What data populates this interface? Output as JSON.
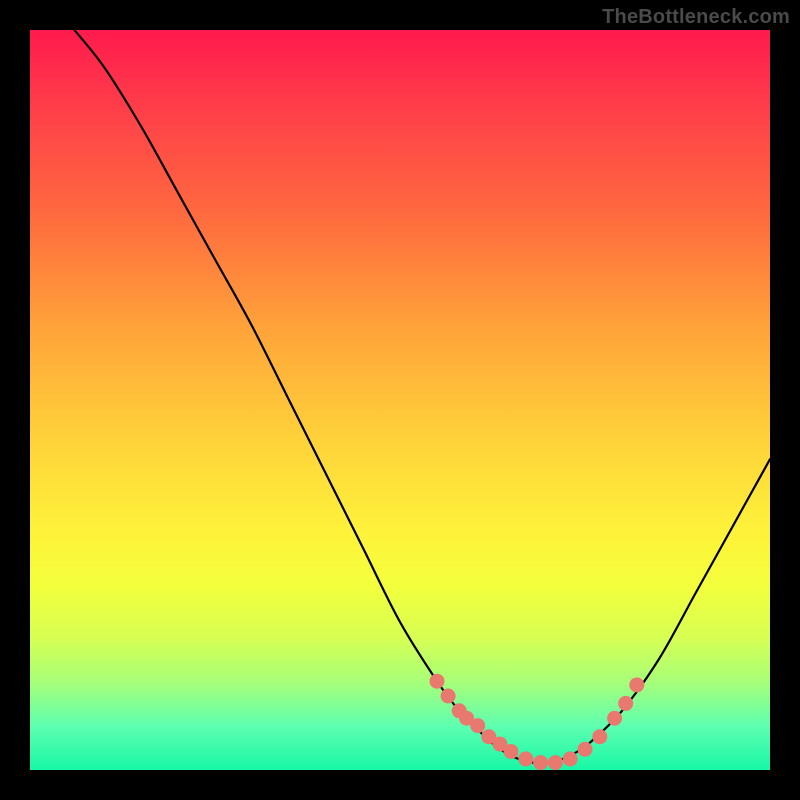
{
  "watermark": "TheBottleneck.com",
  "chart_data": {
    "type": "line",
    "title": "",
    "xlabel": "",
    "ylabel": "",
    "xlim": [
      0,
      100
    ],
    "ylim": [
      0,
      100
    ],
    "legend": false,
    "grid": false,
    "background_gradient": [
      "#ff1a4d",
      "#ffd13a",
      "#17f7a6"
    ],
    "series": [
      {
        "name": "curve",
        "x": [
          6,
          10,
          15,
          20,
          25,
          30,
          35,
          40,
          45,
          50,
          55,
          58,
          60,
          62,
          64,
          66,
          68,
          70,
          72,
          74,
          76,
          80,
          85,
          90,
          95,
          100
        ],
        "y": [
          100,
          95,
          87,
          78,
          69,
          60,
          50,
          40,
          30,
          20,
          12,
          8,
          6,
          4,
          2.5,
          1.5,
          1,
          1,
          1.5,
          2.5,
          4,
          8,
          15,
          24,
          33,
          42
        ]
      }
    ],
    "markers": {
      "name": "highlight-points",
      "color": "#e9786f",
      "x": [
        55,
        56.5,
        58,
        59,
        60.5,
        62,
        63.5,
        65,
        67,
        69,
        71,
        73,
        75,
        77,
        79,
        80.5,
        82
      ],
      "y": [
        12,
        10,
        8,
        7,
        6,
        4.5,
        3.5,
        2.5,
        1.5,
        1,
        1,
        1.5,
        2.8,
        4.5,
        7,
        9,
        11.5
      ]
    }
  }
}
